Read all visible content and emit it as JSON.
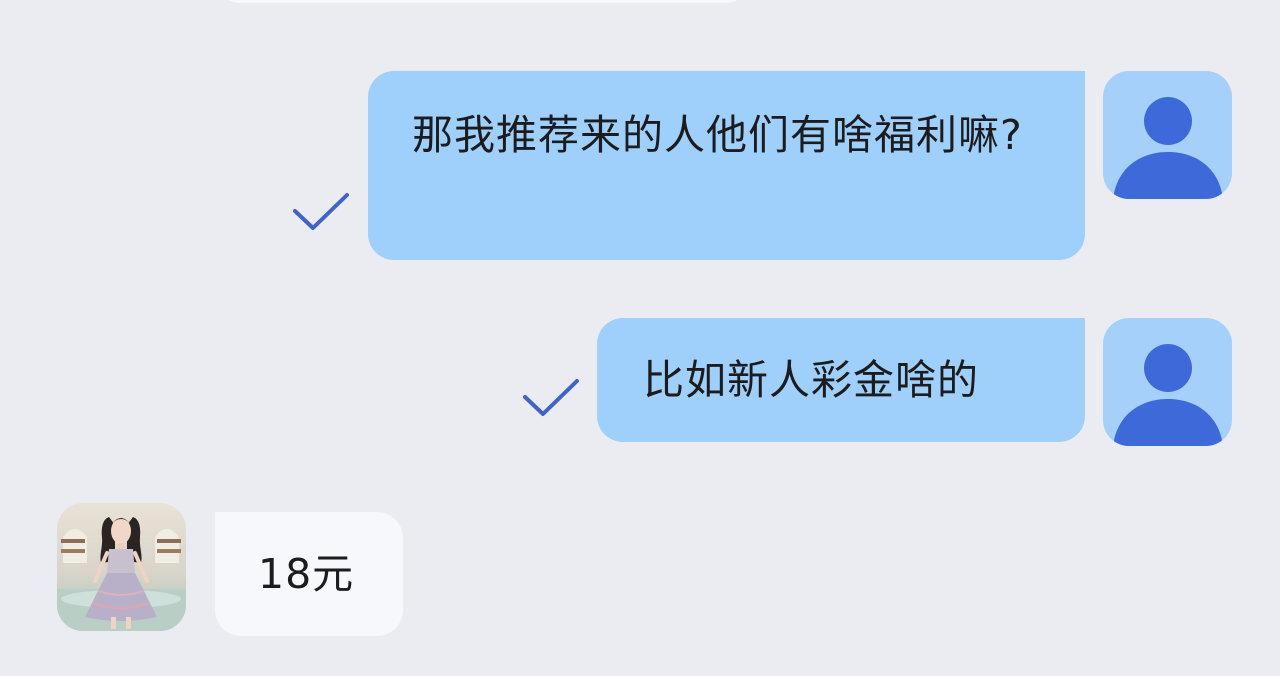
{
  "messages": [
    {
      "id": "msg1",
      "direction": "outgoing",
      "text": "那我推荐来的人他们有啥福利嘛?",
      "read": true
    },
    {
      "id": "msg2",
      "direction": "outgoing",
      "text": "比如新人彩金啥的",
      "read": true
    },
    {
      "id": "msg3",
      "direction": "incoming",
      "text": "18元"
    }
  ],
  "icons": {
    "read_check": "checkmark-icon",
    "self_avatar": "user-silhouette-icon",
    "contact_avatar": "contact-photo-avatar"
  },
  "colors": {
    "background": "#ebebf2",
    "outgoing_bubble": "#9fd0fc",
    "incoming_bubble": "#f7f8fc",
    "self_avatar_bg": "#a5d0fa",
    "self_avatar_icon": "#3d6ad8",
    "read_check": "#3f63c7",
    "text": "#1c1c1e"
  }
}
